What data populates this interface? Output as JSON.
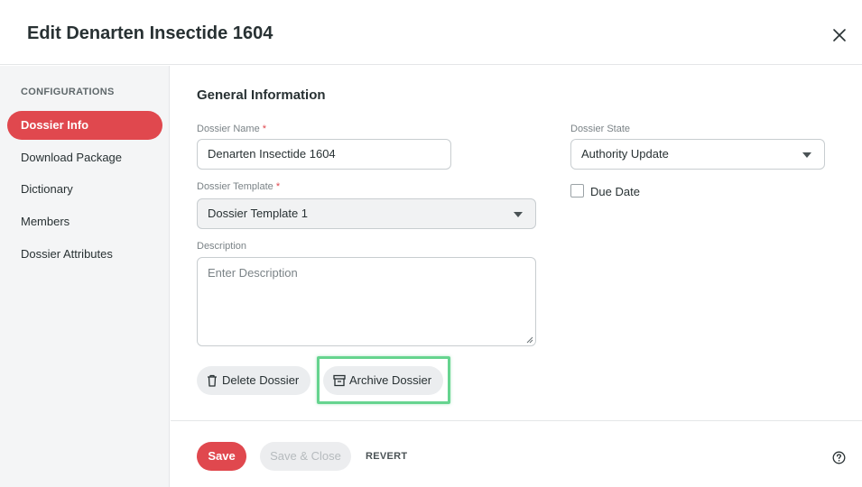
{
  "dialog": {
    "title": "Edit Denarten Insectide 1604"
  },
  "sidebar": {
    "heading": "CONFIGURATIONS",
    "items": [
      {
        "label": "Dossier Info",
        "active": true
      },
      {
        "label": "Download Package",
        "active": false
      },
      {
        "label": "Dictionary",
        "active": false
      },
      {
        "label": "Members",
        "active": false
      },
      {
        "label": "Dossier Attributes",
        "active": false
      }
    ]
  },
  "form": {
    "section_title": "General Information",
    "dossier_name": {
      "label": "Dossier Name",
      "required_mark": "*",
      "value": "Denarten Insectide 1604"
    },
    "dossier_template": {
      "label": "Dossier Template",
      "required_mark": "*",
      "value": "Dossier Template 1"
    },
    "description": {
      "label": "Description",
      "placeholder": "Enter Description"
    },
    "dossier_state": {
      "label": "Dossier State",
      "value": "Authority Update"
    },
    "due_date": {
      "label": "Due Date",
      "checked": false
    }
  },
  "actions": {
    "delete_label": "Delete Dossier",
    "archive_label": "Archive Dossier"
  },
  "footer": {
    "save_label": "Save",
    "save_close_label": "Save & Close",
    "revert_label": "REVERT"
  },
  "icons": {
    "close": "close-icon",
    "trash": "trash-icon",
    "archive": "archive-icon",
    "help": "help-icon",
    "dropdown": "chevron-down-icon"
  },
  "colors": {
    "accent": "#e0484e",
    "highlight": "#66d48f"
  }
}
